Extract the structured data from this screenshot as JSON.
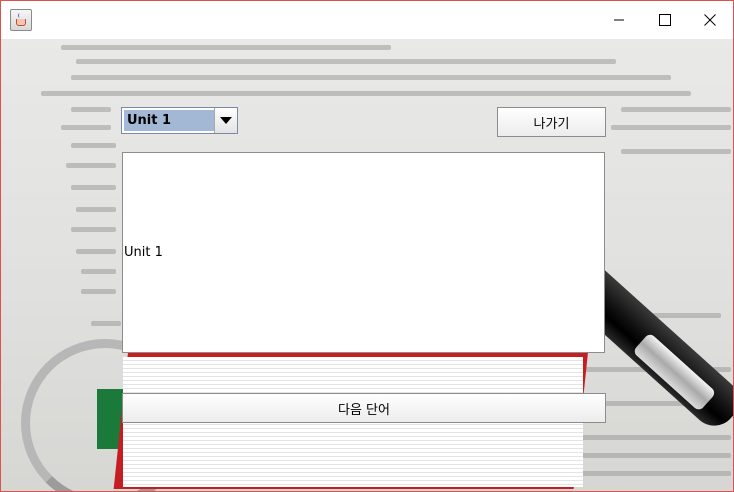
{
  "window": {
    "title": "",
    "accent_border": "#d9534f",
    "controls": {
      "minimize": "minimize-icon",
      "maximize": "maximize-icon",
      "close": "close-icon"
    }
  },
  "unit_select": {
    "selected": "Unit 1"
  },
  "exit_button": {
    "label": "나가기"
  },
  "word_display": {
    "text": "Unit 1"
  },
  "next_button": {
    "label": "다음 단어"
  }
}
